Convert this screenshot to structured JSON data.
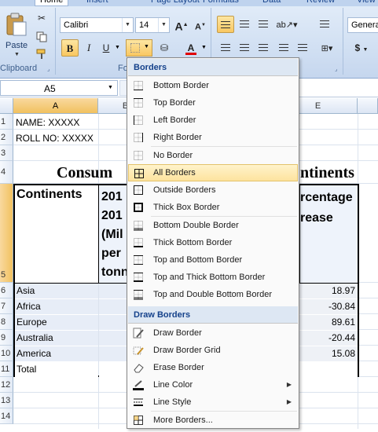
{
  "ribbon": {
    "tabs": [
      {
        "label": "Home",
        "active": true
      },
      {
        "label": "Insert"
      },
      {
        "label": "Page Layout"
      },
      {
        "label": "Formulas"
      },
      {
        "label": "Data"
      },
      {
        "label": "Review"
      },
      {
        "label": "View"
      }
    ],
    "clipboard": {
      "paste": "Paste",
      "group": "Clipboard"
    },
    "font": {
      "name": "Calibri",
      "size": "14",
      "group": "Fo",
      "bold": "B",
      "italic": "I",
      "underline": "U",
      "grow": "A",
      "shrink": "A",
      "color_icon": "A"
    },
    "number": {
      "format": "Genera",
      "currency": "$"
    }
  },
  "formula_bar": {
    "name_box": "A5"
  },
  "sheet": {
    "columns": [
      "A",
      "B",
      "E"
    ],
    "rows": [
      "1",
      "2",
      "3",
      "4",
      "5",
      "6",
      "7",
      "8",
      "9",
      "10",
      "11",
      "12",
      "13",
      "14"
    ],
    "a1": "NAME: XXXXX",
    "a2": "ROLL NO: XXXXX",
    "title_left": "Consum",
    "title_right": "ntinents",
    "header_a": "Continents",
    "header_b_lines": [
      "201",
      "201",
      "(Mil",
      "per",
      "tonn"
    ],
    "header_e_lines": [
      "rcentage",
      "rease"
    ],
    "continents": [
      "Asia",
      "Africa",
      "Europe",
      "Australia",
      "America",
      "Total"
    ],
    "percent": [
      "18.97",
      "-30.84",
      "89.61",
      "-20.44",
      "15.08"
    ]
  },
  "menu": {
    "borders_title": "Borders",
    "items": [
      {
        "label": "Bottom Border",
        "icon": "bottom-border-icon"
      },
      {
        "label": "Top Border",
        "icon": "top-border-icon"
      },
      {
        "label": "Left Border",
        "icon": "left-border-icon"
      },
      {
        "label": "Right Border",
        "icon": "right-border-icon"
      },
      {
        "label": "No Border",
        "icon": "no-border-icon"
      },
      {
        "label": "All Borders",
        "icon": "all-borders-icon",
        "highlighted": true
      },
      {
        "label": "Outside Borders",
        "icon": "outside-borders-icon"
      },
      {
        "label": "Thick Box Border",
        "icon": "thick-box-border-icon"
      },
      {
        "label": "Bottom Double Border",
        "icon": "bottom-double-border-icon"
      },
      {
        "label": "Thick Bottom Border",
        "icon": "thick-bottom-border-icon"
      },
      {
        "label": "Top and Bottom Border",
        "icon": "top-bottom-border-icon"
      },
      {
        "label": "Top and Thick Bottom Border",
        "icon": "top-thick-bottom-border-icon"
      },
      {
        "label": "Top and Double Bottom Border",
        "icon": "top-double-bottom-border-icon"
      }
    ],
    "draw_title": "Draw Borders",
    "draw_items": [
      {
        "label": "Draw Border",
        "icon": "pencil-icon"
      },
      {
        "label": "Draw Border Grid",
        "icon": "pencil-grid-icon"
      },
      {
        "label": "Erase Border",
        "icon": "eraser-icon"
      },
      {
        "label": "Line Color",
        "icon": "line-color-icon",
        "submenu": true
      },
      {
        "label": "Line Style",
        "icon": "line-style-icon",
        "submenu": true
      },
      {
        "label": "More Borders...",
        "icon": "more-borders-icon"
      }
    ]
  },
  "colors": {
    "accent": "#15428b",
    "highlight": "#fde39e",
    "selected_header": "#f1c15f",
    "line_color": "#e00000"
  }
}
